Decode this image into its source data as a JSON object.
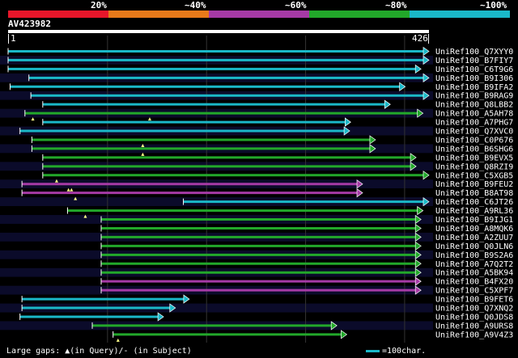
{
  "legend": {
    "labels": [
      "20%",
      "~40%",
      "~60%",
      "~80%",
      "~100%"
    ],
    "colors": [
      "#e8162a",
      "#e87a1a",
      "#a63aa6",
      "#22a82a",
      "#1ab8c8"
    ]
  },
  "query": {
    "id": "AV423982",
    "start": "1",
    "end": "426"
  },
  "footer": {
    "gaps_text": "Large gaps: ▲(in Query)/- (in Subject)",
    "scale_text": "=100char."
  },
  "chart_data": {
    "type": "alignment",
    "query_length": 426,
    "hits": [
      {
        "name": "UniRef100_Q7XYY0",
        "color": "#1ab8c8",
        "start": 1,
        "end": 426,
        "gaps": []
      },
      {
        "name": "UniRef100_B7FIY7",
        "color": "#1ab8c8",
        "start": 1,
        "end": 426,
        "gaps": []
      },
      {
        "name": "UniRef100_C6T9G6",
        "color": "#1ab8c8",
        "start": 1,
        "end": 418,
        "gaps": []
      },
      {
        "name": "UniRef100_B9I306",
        "color": "#1ab8c8",
        "start": 22,
        "end": 426,
        "gaps": []
      },
      {
        "name": "UniRef100_B9IFA2",
        "color": "#1ab8c8",
        "start": 3,
        "end": 402,
        "gaps": []
      },
      {
        "name": "UniRef100_B9RAG9",
        "color": "#1ab8c8",
        "start": 24,
        "end": 426,
        "gaps": []
      },
      {
        "name": "UniRef100_Q8LBB2",
        "color": "#1ab8c8",
        "start": 36,
        "end": 387,
        "gaps": []
      },
      {
        "name": "UniRef100_A5AH78",
        "color": "#22a82a",
        "start": 18,
        "end": 420,
        "gaps": [
          26,
          144
        ]
      },
      {
        "name": "UniRef100_A7PHG7",
        "color": "#1ab8c8",
        "start": 36,
        "end": 347,
        "gaps": []
      },
      {
        "name": "UniRef100_Q7XVC0",
        "color": "#1ab8c8",
        "start": 13,
        "end": 346,
        "gaps": []
      },
      {
        "name": "UniRef100_C0P676",
        "color": "#22a82a",
        "start": 25,
        "end": 372,
        "gaps": [
          137
        ]
      },
      {
        "name": "UniRef100_B6SHG6",
        "color": "#22a82a",
        "start": 25,
        "end": 372,
        "gaps": [
          137
        ]
      },
      {
        "name": "UniRef100_B9EVX5",
        "color": "#22a82a",
        "start": 36,
        "end": 413,
        "gaps": []
      },
      {
        "name": "UniRef100_Q8RZI9",
        "color": "#22a82a",
        "start": 36,
        "end": 413,
        "gaps": []
      },
      {
        "name": "UniRef100_C5XGB5",
        "color": "#22a82a",
        "start": 36,
        "end": 426,
        "gaps": [
          50
        ]
      },
      {
        "name": "UniRef100_B9FEU2",
        "color": "#a63aa6",
        "start": 15,
        "end": 359,
        "gaps": [
          62,
          65
        ]
      },
      {
        "name": "UniRef100_B8AT98",
        "color": "#a63aa6",
        "start": 15,
        "end": 359,
        "gaps": [
          69
        ]
      },
      {
        "name": "UniRef100_C6JT26",
        "color": "#1ab8c8",
        "start": 178,
        "end": 426,
        "gaps": []
      },
      {
        "name": "UniRef100_A9RL36",
        "color": "#22a82a",
        "start": 61,
        "end": 420,
        "gaps": [
          79
        ]
      },
      {
        "name": "UniRef100_B9IJG1",
        "color": "#22a82a",
        "start": 95,
        "end": 418,
        "gaps": []
      },
      {
        "name": "UniRef100_A8MQK6",
        "color": "#22a82a",
        "start": 95,
        "end": 418,
        "gaps": []
      },
      {
        "name": "UniRef100_A2ZUU7",
        "color": "#22a82a",
        "start": 95,
        "end": 418,
        "gaps": []
      },
      {
        "name": "UniRef100_Q0JLN6",
        "color": "#22a82a",
        "start": 95,
        "end": 418,
        "gaps": []
      },
      {
        "name": "UniRef100_B9S2A6",
        "color": "#22a82a",
        "start": 95,
        "end": 418,
        "gaps": []
      },
      {
        "name": "UniRef100_A7Q2T2",
        "color": "#22a82a",
        "start": 95,
        "end": 418,
        "gaps": []
      },
      {
        "name": "UniRef100_A5BK94",
        "color": "#22a82a",
        "start": 95,
        "end": 418,
        "gaps": []
      },
      {
        "name": "UniRef100_B4FX20",
        "color": "#a63aa6",
        "start": 95,
        "end": 418,
        "gaps": []
      },
      {
        "name": "UniRef100_C5XPF7",
        "color": "#a63aa6",
        "start": 95,
        "end": 418,
        "gaps": []
      },
      {
        "name": "UniRef100_B9FET6",
        "color": "#1ab8c8",
        "start": 15,
        "end": 184,
        "gaps": []
      },
      {
        "name": "UniRef100_Q7XNQ2",
        "color": "#1ab8c8",
        "start": 15,
        "end": 170,
        "gaps": []
      },
      {
        "name": "UniRef100_Q0JDS8",
        "color": "#1ab8c8",
        "start": 13,
        "end": 158,
        "gaps": []
      },
      {
        "name": "UniRef100_A9URS8",
        "color": "#22a82a",
        "start": 86,
        "end": 333,
        "gaps": []
      },
      {
        "name": "UniRef100_A9V4Z3",
        "color": "#22a82a",
        "start": 107,
        "end": 343,
        "gaps": [
          112
        ]
      }
    ]
  }
}
